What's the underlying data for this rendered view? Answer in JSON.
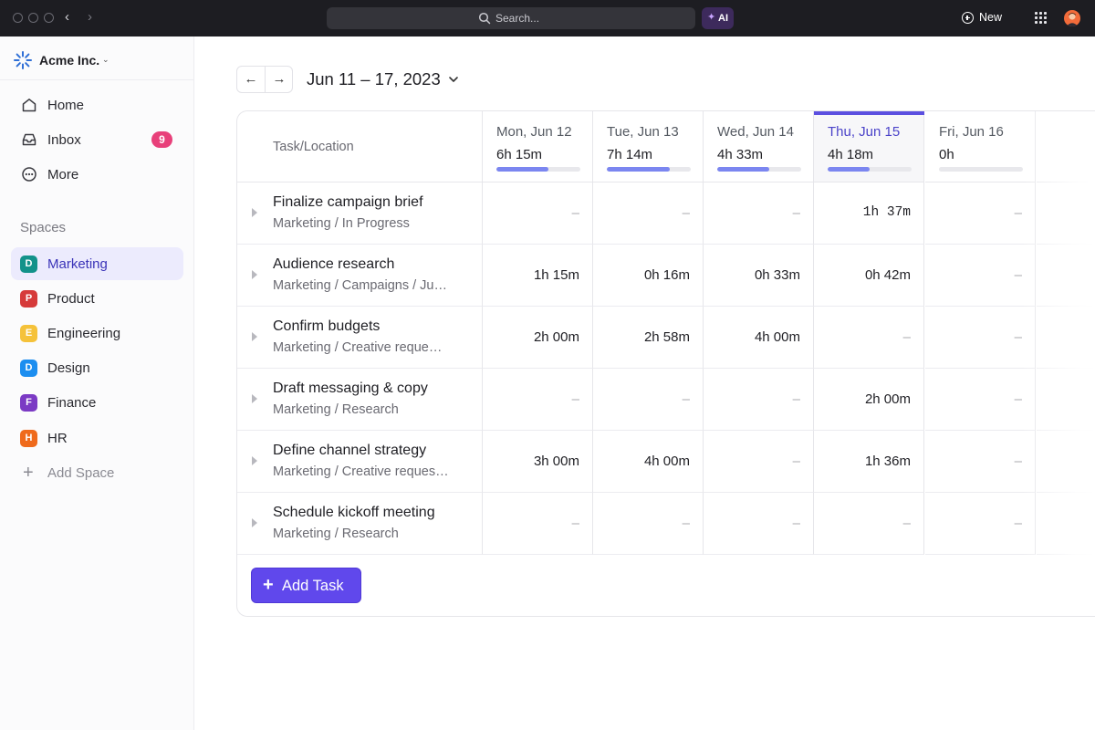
{
  "topbar": {
    "search_placeholder": "Search...",
    "ai_label": "AI",
    "new_label": "New"
  },
  "sidebar": {
    "workspace_name": "Acme Inc.",
    "nav": [
      {
        "label": "Home",
        "icon": "home-icon"
      },
      {
        "label": "Inbox",
        "icon": "inbox-icon",
        "badge": "9"
      },
      {
        "label": "More",
        "icon": "more-icon"
      }
    ],
    "spaces_heading": "Spaces",
    "spaces": [
      {
        "initial": "D",
        "label": "Marketing",
        "color": "#13928a",
        "active": true
      },
      {
        "initial": "P",
        "label": "Product",
        "color": "#d63a3a"
      },
      {
        "initial": "E",
        "label": "Engineering",
        "color": "#f5c23a"
      },
      {
        "initial": "D",
        "label": "Design",
        "color": "#1c8ef0"
      },
      {
        "initial": "F",
        "label": "Finance",
        "color": "#7b3ac4"
      },
      {
        "initial": "H",
        "label": "HR",
        "color": "#ef6a1c"
      }
    ],
    "add_space_label": "Add Space"
  },
  "main": {
    "date_range": "Jun 11 – 17, 2023",
    "prev_label": "←",
    "next_label": "→",
    "table": {
      "task_header": "Task/Location",
      "days": [
        {
          "name": "Mon, Jun 12",
          "total": "6h 15m",
          "progress": 0.62
        },
        {
          "name": "Tue, Jun 13",
          "total": "7h 14m",
          "progress": 0.75
        },
        {
          "name": "Wed, Jun 14",
          "total": "4h 33m",
          "progress": 0.62
        },
        {
          "name": "Thu, Jun 15",
          "total": "4h 18m",
          "progress": 0.5,
          "today": true
        },
        {
          "name": "Fri, Jun 16",
          "total": "0h",
          "progress": 0
        }
      ],
      "rows": [
        {
          "name": "Finalize campaign brief",
          "location": "Marketing / In Progress",
          "values": [
            "–",
            "–",
            "–",
            "1h 37m",
            "–"
          ]
        },
        {
          "name": "Audience research",
          "location": "Marketing / Campaigns / Ju…",
          "values": [
            "1h 15m",
            "0h 16m",
            "0h 33m",
            "0h 42m",
            "–"
          ]
        },
        {
          "name": "Confirm budgets",
          "location": "Marketing / Creative reque…",
          "values": [
            "2h 00m",
            "2h 58m",
            "4h 00m",
            "–",
            "–"
          ]
        },
        {
          "name": "Draft messaging & copy",
          "location": "Marketing / Research",
          "values": [
            "–",
            "–",
            "–",
            "2h 00m",
            "–"
          ]
        },
        {
          "name": "Define channel strategy",
          "location": "Marketing / Creative reques…",
          "values": [
            "3h 00m",
            "4h 00m",
            "–",
            "1h 36m",
            "–"
          ]
        },
        {
          "name": "Schedule kickoff meeting",
          "location": "Marketing / Research",
          "values": [
            "–",
            "–",
            "–",
            "–",
            "–"
          ]
        }
      ]
    },
    "add_task_label": "Add Task"
  },
  "colors": {
    "accent": "#6048ec",
    "progress": "#7b86f0",
    "today_bar": "#5b4fe0",
    "badge": "#e8407a"
  }
}
